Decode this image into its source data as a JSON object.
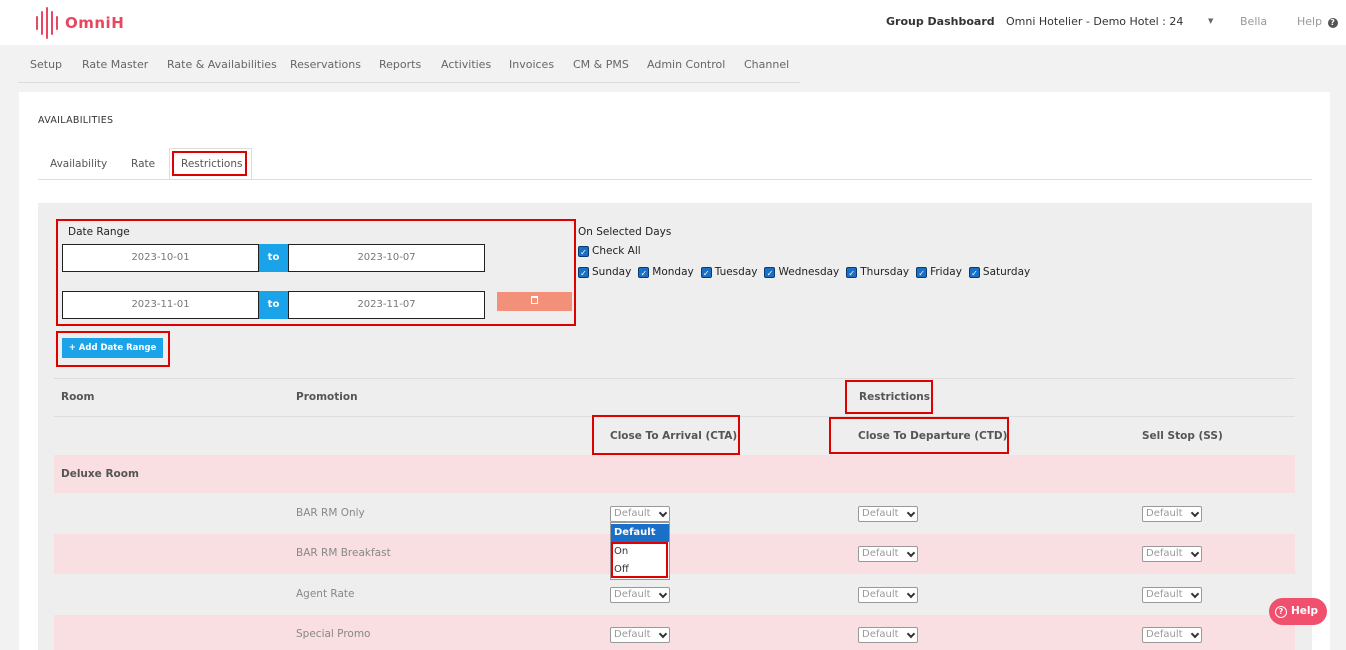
{
  "app": {
    "brand": "OmniH",
    "brand_color": "#e8475f"
  },
  "header": {
    "group_dashboard": "Group Dashboard",
    "hotel": "Omni Hotelier - Demo Hotel : 24",
    "user": "Bella",
    "help": "Help"
  },
  "nav": {
    "items": [
      "Setup",
      "Rate Master",
      "Rate & Availabilities",
      "Reservations",
      "Reports",
      "Activities",
      "Invoices",
      "CM & PMS",
      "Admin Control",
      "Channel"
    ]
  },
  "page": {
    "title": "AVAILABILITIES",
    "tabs": [
      "Availability",
      "Rate",
      "Restrictions"
    ],
    "active_tab": "Restrictions"
  },
  "date_range": {
    "label": "Date Range",
    "to_label": "to",
    "ranges": [
      {
        "from": "2023-10-01",
        "to": "2023-10-07"
      },
      {
        "from": "2023-11-01",
        "to": "2023-11-07"
      }
    ],
    "add_label": "+ Add Date Range"
  },
  "days": {
    "label": "On Selected Days",
    "check_all": "Check All",
    "list": [
      "Sunday",
      "Monday",
      "Tuesday",
      "Wednesday",
      "Thursday",
      "Friday",
      "Saturday"
    ]
  },
  "table": {
    "col_room": "Room",
    "col_promotion": "Promotion",
    "col_restrictions": "Restrictions",
    "col_cta": "Close To Arrival (CTA)",
    "col_ctd": "Close To Departure (CTD)",
    "col_ss": "Sell Stop (SS)",
    "room_name": "Deluxe Room",
    "rows": [
      {
        "promotion": "BAR RM Only",
        "cta": "Default",
        "ctd": "Default",
        "ss": "Default"
      },
      {
        "promotion": "BAR RM Breakfast",
        "cta": "Default",
        "ctd": "Default",
        "ss": "Default"
      },
      {
        "promotion": "Agent Rate",
        "cta": "Default",
        "ctd": "Default",
        "ss": "Default"
      },
      {
        "promotion": "Special Promo",
        "cta": "Default",
        "ctd": "Default",
        "ss": "Default"
      }
    ]
  },
  "dropdown_options": [
    "Default",
    "On",
    "Off"
  ],
  "help_button": "Help"
}
